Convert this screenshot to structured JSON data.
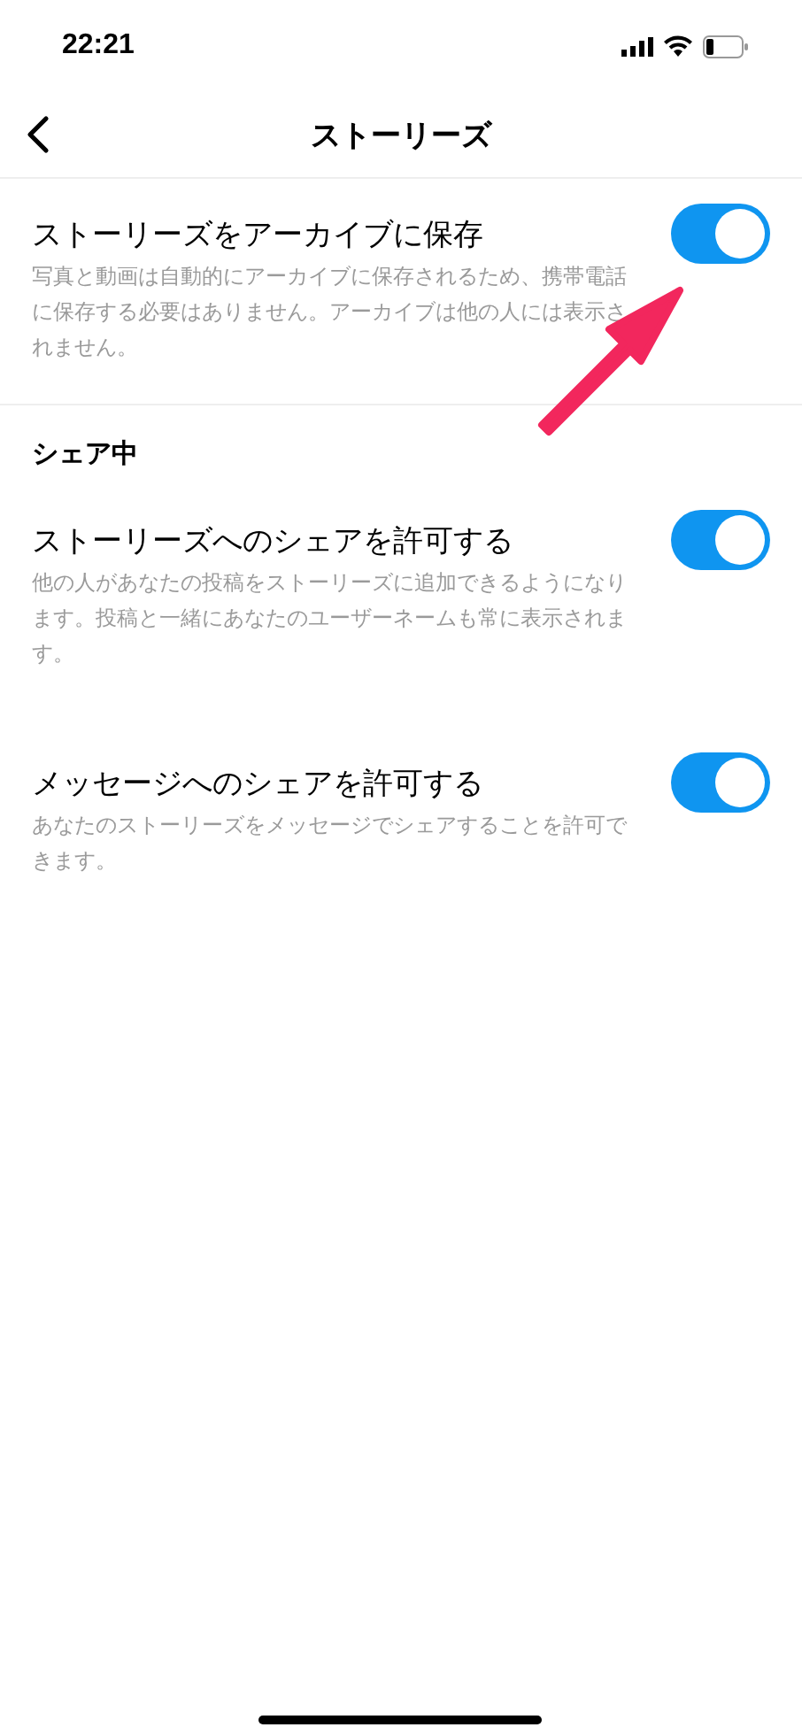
{
  "status_bar": {
    "time": "22:21"
  },
  "nav": {
    "title": "ストーリーズ"
  },
  "sections": [
    {
      "rows": [
        {
          "title": "ストーリーズをアーカイブに保存",
          "description": "写真と動画は自動的にアーカイブに保存されるため、携帯電話に保存する必要はありません。アーカイブは他の人には表示されません。",
          "on": true
        }
      ]
    },
    {
      "header": "シェア中",
      "rows": [
        {
          "title": "ストーリーズへのシェアを許可する",
          "description": "他の人があなたの投稿をストーリーズに追加できるようになります。投稿と一緒にあなたのユーザーネームも常に表示されます。",
          "on": true
        },
        {
          "title": "メッセージへのシェアを許可する",
          "description": "あなたのストーリーズをメッセージでシェアすることを許可できます。",
          "on": true
        }
      ]
    }
  ]
}
